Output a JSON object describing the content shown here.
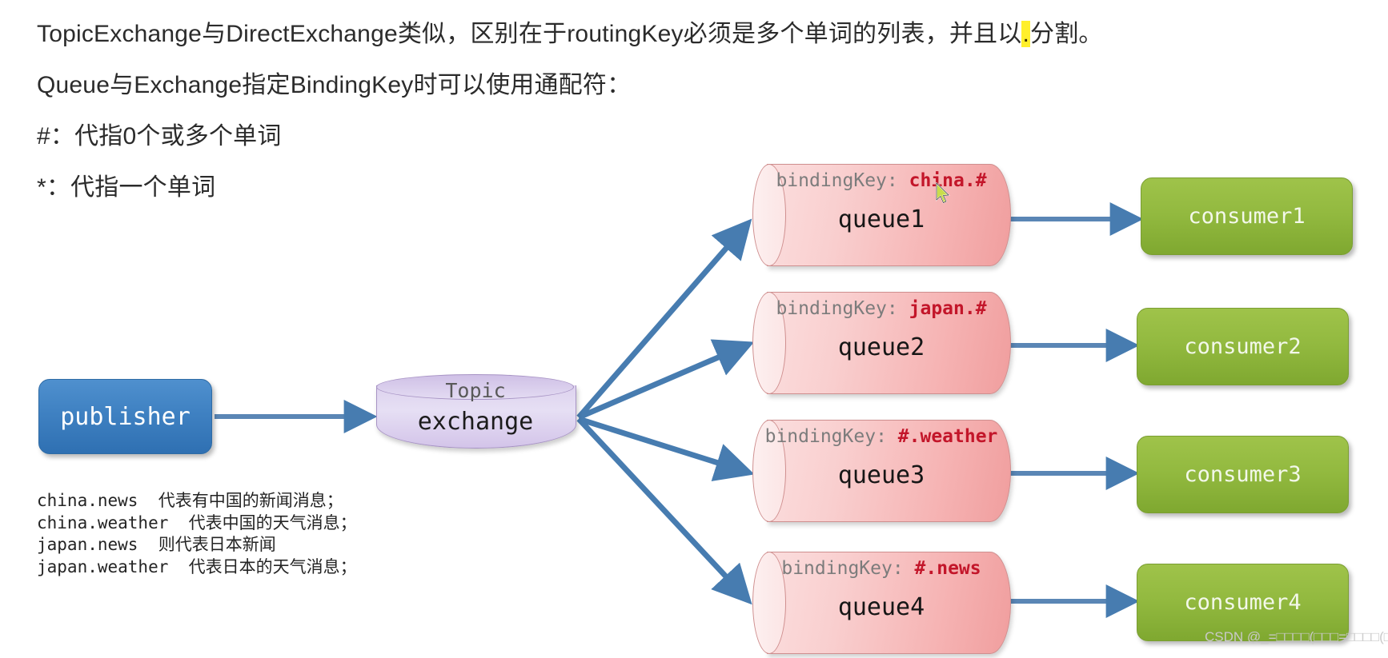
{
  "prose": {
    "line1_a": "TopicExchange与DirectExchange类似，区别在于routingKey必须是多个单词的列表，并且以",
    "line1_highlight": ".",
    "line1_b": "分割。",
    "line2": "Queue与Exchange指定BindingKey时可以使用通配符：",
    "line3": "#：代指0个或多个单词",
    "line4": "*：代指一个单词"
  },
  "legend": {
    "lines": [
      "china.news  代表有中国的新闻消息；",
      "china.weather  代表中国的天气消息；",
      "japan.news  则代表日本新闻",
      "japan.weather  代表日本的天气消息；"
    ]
  },
  "diagram": {
    "publisher": {
      "label": "publisher"
    },
    "exchange": {
      "type_label": "Topic",
      "label": "exchange"
    },
    "queues": [
      {
        "key_label": "bindingKey:",
        "key_value": "china.#",
        "name": "queue1"
      },
      {
        "key_label": "bindingKey:",
        "key_value": "japan.#",
        "name": "queue2"
      },
      {
        "key_label": "bindingKey:",
        "key_value": "#.weather",
        "name": "queue3"
      },
      {
        "key_label": "bindingKey:",
        "key_value": "#.news",
        "name": "queue4"
      }
    ],
    "consumers": [
      {
        "label": "consumer1"
      },
      {
        "label": "consumer2"
      },
      {
        "label": "consumer3"
      },
      {
        "label": "consumer4"
      }
    ],
    "colors": {
      "publisher_blue": "#3f81c2",
      "consumer_green": "#92b93f",
      "exchange_purple": "#ddd2ee",
      "queue_pink": "#f6b4b4",
      "arrow_blue": "#477cb0",
      "binding_key_red": "#c3162a",
      "highlight_yellow": "#ffef2b"
    }
  },
  "watermark": {
    "text": "CSDN @_=□□□□(□□□=□□□□(□□"
  }
}
